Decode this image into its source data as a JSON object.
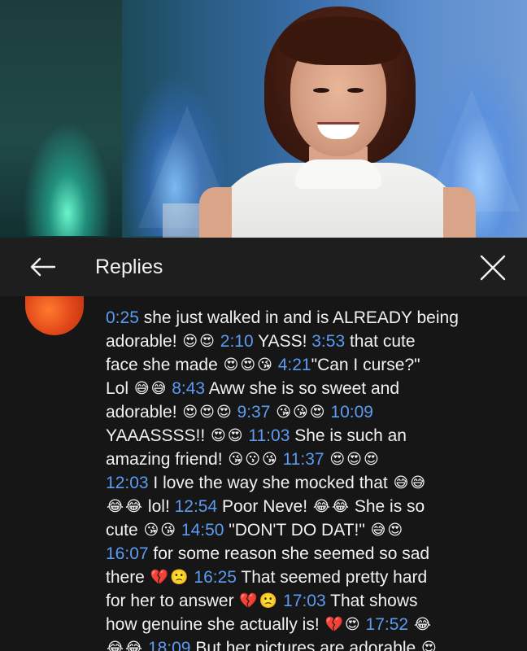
{
  "header": {
    "title": "Replies"
  },
  "comment": {
    "lines": [
      [
        {
          "t": "ts",
          "v": "0:25"
        },
        {
          "t": "x",
          "v": " she just walked in and is ALREADY being"
        }
      ],
      [
        {
          "t": "x",
          "v": "adorable! "
        },
        {
          "t": "e",
          "v": "😍"
        },
        {
          "t": "e",
          "v": "😍"
        },
        {
          "t": "x",
          "v": " "
        },
        {
          "t": "ts",
          "v": "2:10"
        },
        {
          "t": "x",
          "v": " YASS! "
        },
        {
          "t": "ts",
          "v": "3:53"
        },
        {
          "t": "x",
          "v": " that cute"
        }
      ],
      [
        {
          "t": "x",
          "v": "face she made "
        },
        {
          "t": "e",
          "v": "😍"
        },
        {
          "t": "e",
          "v": "😍"
        },
        {
          "t": "e",
          "v": "😘"
        },
        {
          "t": "x",
          "v": " "
        },
        {
          "t": "ts",
          "v": "4:21"
        },
        {
          "t": "x",
          "v": "\"Can I curse?\""
        }
      ],
      [
        {
          "t": "x",
          "v": "Lol "
        },
        {
          "t": "e",
          "v": "😅"
        },
        {
          "t": "e",
          "v": "😅"
        },
        {
          "t": "x",
          "v": " "
        },
        {
          "t": "ts",
          "v": "8:43"
        },
        {
          "t": "x",
          "v": " Aww she is so sweet and"
        }
      ],
      [
        {
          "t": "x",
          "v": "adorable! "
        },
        {
          "t": "e",
          "v": "😍"
        },
        {
          "t": "e",
          "v": "😍"
        },
        {
          "t": "e",
          "v": "😍"
        },
        {
          "t": "x",
          "v": " "
        },
        {
          "t": "ts",
          "v": "9:37"
        },
        {
          "t": "x",
          "v": " "
        },
        {
          "t": "e",
          "v": "😘"
        },
        {
          "t": "e",
          "v": "😘"
        },
        {
          "t": "e",
          "v": "😍"
        },
        {
          "t": "x",
          "v": " "
        },
        {
          "t": "ts",
          "v": "10:09"
        }
      ],
      [
        {
          "t": "x",
          "v": "YAAASSSS!! "
        },
        {
          "t": "e",
          "v": "😍"
        },
        {
          "t": "e",
          "v": "😍"
        },
        {
          "t": "x",
          "v": " "
        },
        {
          "t": "ts",
          "v": "11:03"
        },
        {
          "t": "x",
          "v": " She is such an"
        }
      ],
      [
        {
          "t": "x",
          "v": "amazing friend! "
        },
        {
          "t": "e",
          "v": "😘"
        },
        {
          "t": "e",
          "v": "😗"
        },
        {
          "t": "e",
          "v": "😘"
        },
        {
          "t": "x",
          "v": " "
        },
        {
          "t": "ts",
          "v": "11:37"
        },
        {
          "t": "x",
          "v": " "
        },
        {
          "t": "e",
          "v": "😍"
        },
        {
          "t": "e",
          "v": "😍"
        },
        {
          "t": "e",
          "v": "😍"
        }
      ],
      [
        {
          "t": "ts",
          "v": "12:03"
        },
        {
          "t": "x",
          "v": " I love the way she mocked that "
        },
        {
          "t": "e",
          "v": "😅"
        },
        {
          "t": "e",
          "v": "😅"
        }
      ],
      [
        {
          "t": "e",
          "v": "😂"
        },
        {
          "t": "e",
          "v": "😂"
        },
        {
          "t": "x",
          "v": " lol! "
        },
        {
          "t": "ts",
          "v": "12:54"
        },
        {
          "t": "x",
          "v": " Poor Neve! "
        },
        {
          "t": "e",
          "v": "😂"
        },
        {
          "t": "e",
          "v": "😂"
        },
        {
          "t": "x",
          "v": " She is so"
        }
      ],
      [
        {
          "t": "x",
          "v": "cute "
        },
        {
          "t": "e",
          "v": "😘"
        },
        {
          "t": "e",
          "v": "😘"
        },
        {
          "t": "x",
          "v": " "
        },
        {
          "t": "ts",
          "v": "14:50"
        },
        {
          "t": "x",
          "v": " \"DON'T DO DAT!\" "
        },
        {
          "t": "e",
          "v": "😅"
        },
        {
          "t": "e",
          "v": "😍"
        }
      ],
      [
        {
          "t": "ts",
          "v": "16:07"
        },
        {
          "t": "x",
          "v": " for some reason she seemed so sad"
        }
      ],
      [
        {
          "t": "x",
          "v": "there "
        },
        {
          "t": "e",
          "v": "💔"
        },
        {
          "t": "e",
          "v": "🙁"
        },
        {
          "t": "x",
          "v": " "
        },
        {
          "t": "ts",
          "v": "16:25"
        },
        {
          "t": "x",
          "v": " That seemed pretty hard"
        }
      ],
      [
        {
          "t": "x",
          "v": "for her to answer "
        },
        {
          "t": "e",
          "v": "💔"
        },
        {
          "t": "e",
          "v": "🙁"
        },
        {
          "t": "x",
          "v": " "
        },
        {
          "t": "ts",
          "v": "17:03"
        },
        {
          "t": "x",
          "v": " That shows"
        }
      ],
      [
        {
          "t": "x",
          "v": "how genuine she actually is! "
        },
        {
          "t": "e",
          "v": "💔"
        },
        {
          "t": "e",
          "v": "😍"
        },
        {
          "t": "x",
          "v": " "
        },
        {
          "t": "ts",
          "v": "17:52"
        },
        {
          "t": "x",
          "v": " "
        },
        {
          "t": "e",
          "v": "😂"
        }
      ],
      [
        {
          "t": "e",
          "v": "😂"
        },
        {
          "t": "e",
          "v": "😂"
        },
        {
          "t": "x",
          "v": " "
        },
        {
          "t": "ts",
          "v": "18:09"
        },
        {
          "t": "x",
          "v": " But her pictures are adorable "
        },
        {
          "t": "e",
          "v": "😍"
        }
      ]
    ]
  },
  "icons": {
    "back": "arrow-left-icon",
    "close": "close-icon"
  },
  "colors": {
    "timestamp": "#5b9cf2",
    "text": "#f1f1f1",
    "background": "#161616",
    "header_bg": "#1e1e1e"
  }
}
